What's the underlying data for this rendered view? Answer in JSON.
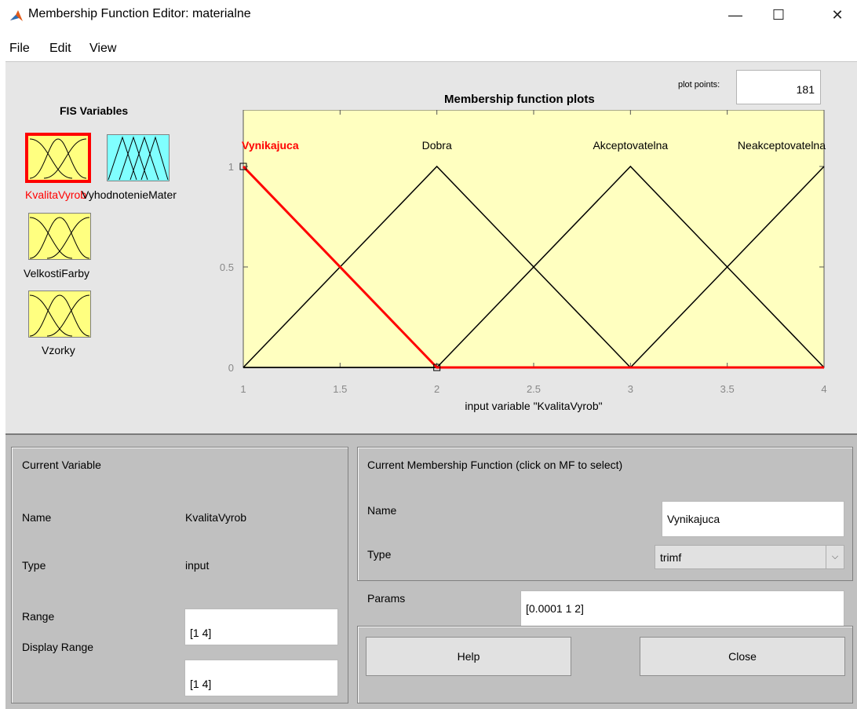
{
  "window": {
    "title": "Membership Function Editor: materialne",
    "minimize": "—",
    "maximize": "☐",
    "close": "✕"
  },
  "menu": [
    "File",
    "Edit",
    "View"
  ],
  "fis_variables": {
    "label": "FIS Variables",
    "items": [
      {
        "name": "KvalitaVyrob",
        "color": "#ffff80",
        "selected": true
      },
      {
        "name": "VyhodnotenieMater",
        "color": "#80ffff",
        "selected": false
      },
      {
        "name": "VelkostiFarby",
        "color": "#ffff80",
        "selected": false
      },
      {
        "name": "Vzorky",
        "color": "#ffff80",
        "selected": false
      }
    ]
  },
  "plot_points": {
    "label": "plot points:",
    "value": "181"
  },
  "chart_data": {
    "type": "line",
    "title": "Membership function plots",
    "xlabel": "input variable \"KvalitaVyrob\"",
    "xlim": [
      1,
      4
    ],
    "ylim": [
      0,
      1
    ],
    "x_ticks": [
      "1",
      "1.5",
      "2",
      "2.5",
      "3",
      "3.5",
      "4"
    ],
    "y_ticks": [
      "0",
      "0.5",
      "1"
    ],
    "background": "#ffffc0",
    "selected_color": "#ff0000",
    "series": [
      {
        "name": "Vynikajuca",
        "type": "trimf",
        "points": [
          [
            1,
            1
          ],
          [
            2,
            0
          ],
          [
            4,
            0
          ]
        ],
        "selected": true
      },
      {
        "name": "Dobra",
        "type": "trimf",
        "points": [
          [
            1,
            0
          ],
          [
            2,
            1
          ],
          [
            3,
            0
          ],
          [
            4,
            0
          ]
        ],
        "selected": false
      },
      {
        "name": "Akceptovatelna",
        "type": "trimf",
        "points": [
          [
            1,
            0
          ],
          [
            2,
            0
          ],
          [
            3,
            1
          ],
          [
            4,
            0
          ]
        ],
        "selected": false
      },
      {
        "name": "Neakceptovatelna",
        "type": "trimf",
        "points": [
          [
            1,
            0
          ],
          [
            3,
            0
          ],
          [
            4,
            1
          ]
        ],
        "selected": false
      }
    ]
  },
  "current_variable": {
    "title": "Current Variable",
    "name_label": "Name",
    "name_value": "KvalitaVyrob",
    "type_label": "Type",
    "type_value": "input",
    "range_label": "Range",
    "range_value": "[1 4]",
    "display_range_label": "Display Range",
    "display_range_value": "[1 4]"
  },
  "current_mf": {
    "title": "Current Membership Function (click on MF to select)",
    "name_label": "Name",
    "name_value": "Vynikajuca",
    "type_label": "Type",
    "type_value": "trimf",
    "params_label": "Params",
    "params_value": "[0.0001 1 2]"
  },
  "buttons": {
    "help": "Help",
    "close": "Close"
  }
}
